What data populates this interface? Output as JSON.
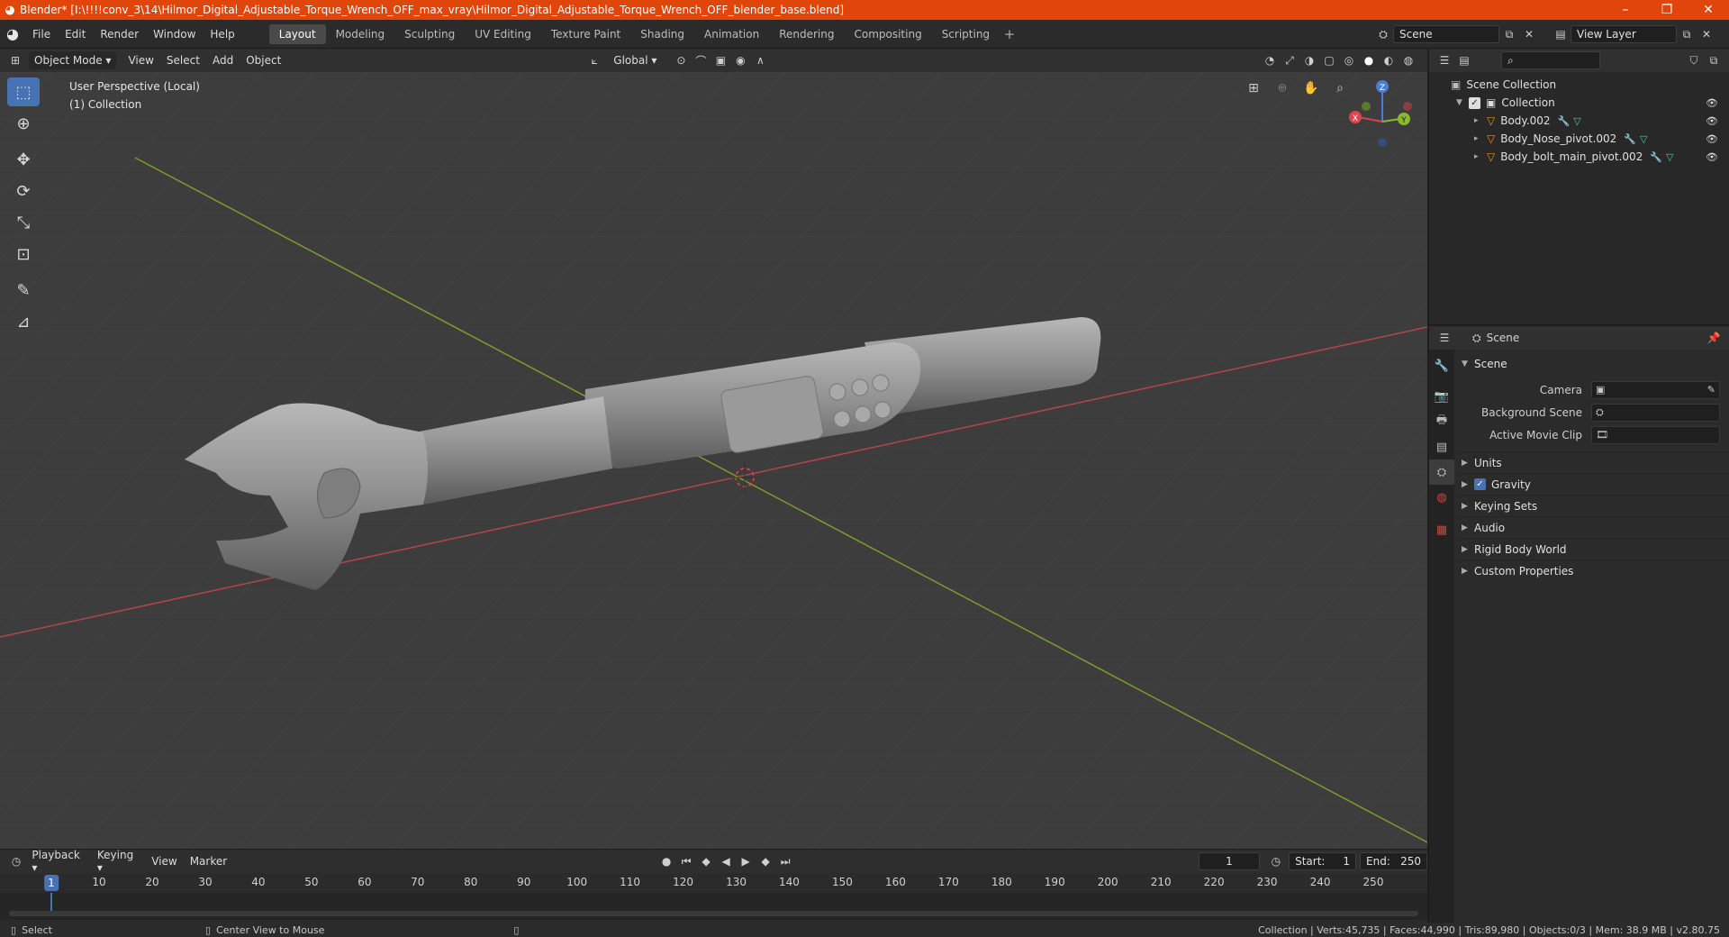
{
  "window": {
    "title": "Blender* [I:\\!!!!conv_3\\14\\Hilmor_Digital_Adjustable_Torque_Wrench_OFF_max_vray\\Hilmor_Digital_Adjustable_Torque_Wrench_OFF_blender_base.blend]",
    "min": "–",
    "max": "❐",
    "close": "✕"
  },
  "menu": [
    "File",
    "Edit",
    "Render",
    "Window",
    "Help"
  ],
  "workspaces": [
    "Layout",
    "Modeling",
    "Sculpting",
    "UV Editing",
    "Texture Paint",
    "Shading",
    "Animation",
    "Rendering",
    "Compositing",
    "Scripting"
  ],
  "active_workspace": "Layout",
  "scene_name": "Scene",
  "view_layer": "View Layer",
  "viewport_header": {
    "mode": "Object Mode",
    "menus": [
      "View",
      "Select",
      "Add",
      "Object"
    ],
    "orientation": "Global"
  },
  "viewport": {
    "perspective": "User Perspective (Local)",
    "collection": "(1) Collection",
    "gizmo": {
      "x": "X",
      "y": "Y",
      "z": "Z"
    }
  },
  "outliner": {
    "root": "Scene Collection",
    "collection": "Collection",
    "objects": [
      "Body.002",
      "Body_Nose_pivot.002",
      "Body_bolt_main_pivot.002"
    ]
  },
  "properties": {
    "header": "Scene",
    "panel": "Scene",
    "camera_label": "Camera",
    "background_label": "Background Scene",
    "movie_clip_label": "Active Movie Clip",
    "subpanels": [
      "Units",
      "Gravity",
      "Keying Sets",
      "Audio",
      "Rigid Body World",
      "Custom Properties"
    ]
  },
  "timeline": {
    "menus": [
      "Playback",
      "Keying",
      "View",
      "Marker"
    ],
    "current_frame": "1",
    "start_label": "Start:",
    "start": "1",
    "end_label": "End:",
    "end": "250",
    "ticks": [
      "1",
      "10",
      "20",
      "30",
      "40",
      "50",
      "60",
      "70",
      "80",
      "90",
      "100",
      "110",
      "120",
      "130",
      "140",
      "150",
      "160",
      "170",
      "180",
      "190",
      "200",
      "210",
      "220",
      "230",
      "240",
      "250"
    ]
  },
  "statusbar": {
    "left": "Select",
    "middle": "Center View to Mouse",
    "right": "Collection | Verts:45,735 | Faces:44,990 | Tris:89,980 | Objects:0/3 | Mem: 38.9 MB | v2.80.75"
  },
  "colors": {
    "titlebar": "#e0460a",
    "accent": "#4772b3",
    "axis_x": "#c8454a",
    "axis_y": "#8aa62e"
  }
}
